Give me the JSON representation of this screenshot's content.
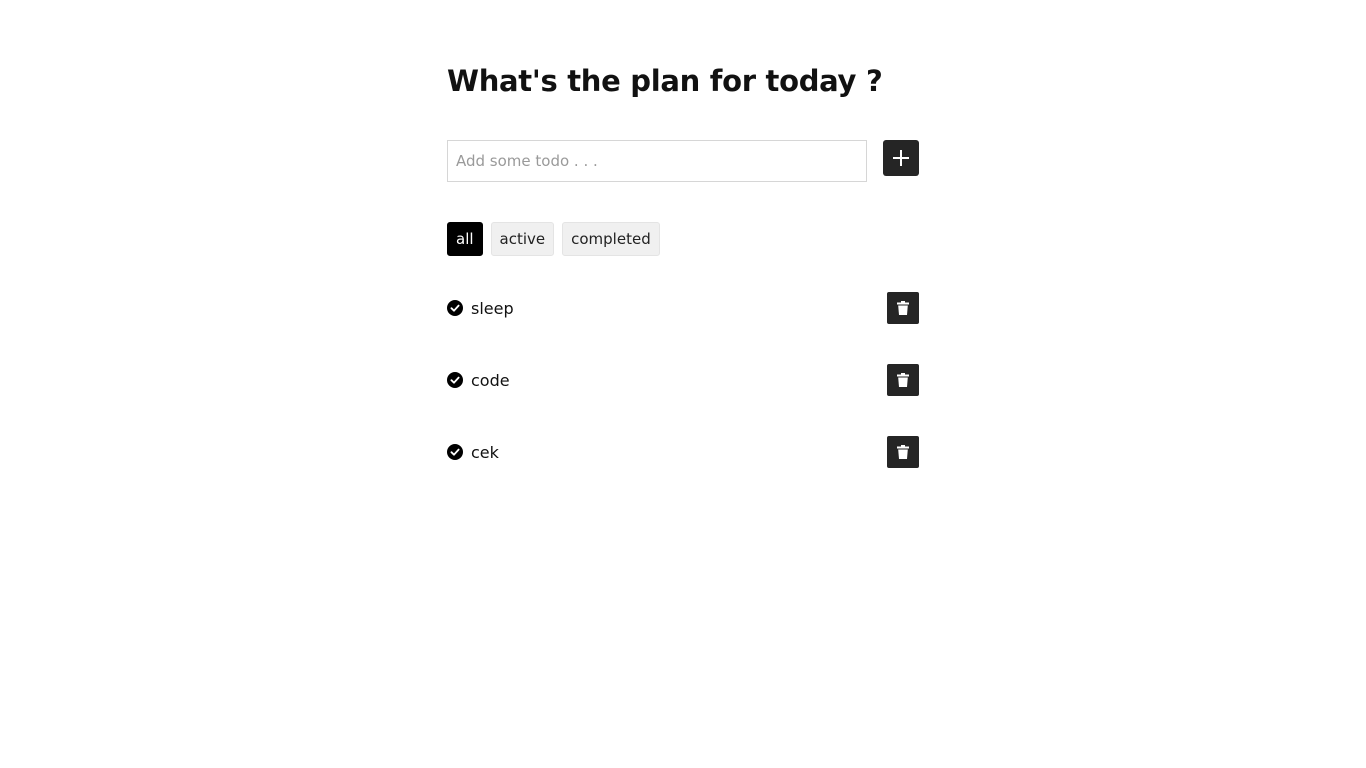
{
  "header": {
    "title": "What's the plan for today ?"
  },
  "form": {
    "input_value": "",
    "placeholder": "Add some todo . . .",
    "add_icon": "plus-icon"
  },
  "filters": [
    {
      "label": "all",
      "selected": true
    },
    {
      "label": "active",
      "selected": false
    },
    {
      "label": "completed",
      "selected": false
    }
  ],
  "todos": [
    {
      "text": "sleep",
      "completed": true,
      "status_icon": "check-circle-icon",
      "delete_icon": "trash-icon"
    },
    {
      "text": "code",
      "completed": true,
      "status_icon": "check-circle-icon",
      "delete_icon": "trash-icon"
    },
    {
      "text": "cek",
      "completed": true,
      "status_icon": "check-circle-icon",
      "delete_icon": "trash-icon"
    }
  ],
  "colors": {
    "accent": "#252525",
    "selected_filter_bg": "#000000",
    "filter_bg": "#f0f0f0"
  }
}
